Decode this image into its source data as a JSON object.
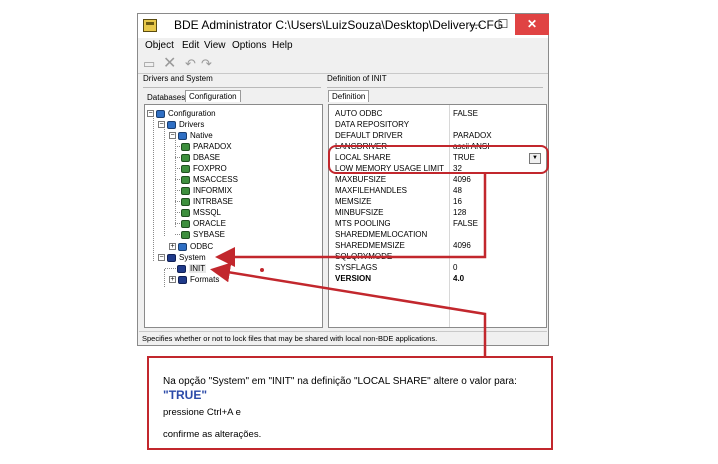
{
  "window": {
    "title": "BDE Administrator  C:\\Users\\LuizSouza\\Desktop\\Delivery.CFG",
    "minimize": "—",
    "maximize": "☐",
    "close": "✕"
  },
  "menu": [
    "Object",
    "Edit",
    "View",
    "Options",
    "Help"
  ],
  "left_panel": {
    "header": "Drivers and System",
    "tabs": [
      "Databases",
      "Configuration"
    ],
    "active_tab": "Configuration",
    "tree": {
      "configuration": "Configuration",
      "drivers": "Drivers",
      "native": "Native",
      "native_drivers": [
        "PARADOX",
        "DBASE",
        "FOXPRO",
        "MSACCESS",
        "INFORMIX",
        "INTRBASE",
        "MSSQL",
        "ORACLE",
        "SYBASE"
      ],
      "odbc": "ODBC",
      "system": "System",
      "init": "INIT",
      "formats": "Formats"
    }
  },
  "right_panel": {
    "header": "Definition of INIT",
    "tab": "Definition",
    "rows": [
      {
        "key": "AUTO ODBC",
        "value": "FALSE"
      },
      {
        "key": "DATA REPOSITORY",
        "value": ""
      },
      {
        "key": "DEFAULT DRIVER",
        "value": "PARADOX"
      },
      {
        "key": "LANGDRIVER",
        "value": "ascii ANSI"
      },
      {
        "key": "LOCAL SHARE",
        "value": "TRUE"
      },
      {
        "key": "LOW MEMORY USAGE LIMIT",
        "value": "32"
      },
      {
        "key": "MAXBUFSIZE",
        "value": "4096"
      },
      {
        "key": "MAXFILEHANDLES",
        "value": "48"
      },
      {
        "key": "MEMSIZE",
        "value": "16"
      },
      {
        "key": "MINBUFSIZE",
        "value": "128"
      },
      {
        "key": "MTS POOLING",
        "value": "FALSE"
      },
      {
        "key": "SHAREDMEMLOCATION",
        "value": ""
      },
      {
        "key": "SHAREDMEMSIZE",
        "value": "4096"
      },
      {
        "key": "SQLQRYMODE",
        "value": ""
      },
      {
        "key": "SYSFLAGS",
        "value": "0"
      },
      {
        "key": "VERSION",
        "value": "4.0"
      }
    ],
    "dropdown_arrow": "▼"
  },
  "status_bar": "Specifies whether or not to lock files that may be shared with local non-BDE applications.",
  "callout": {
    "line1": "Na opção \"System\" em \"INIT\" na definição \"LOCAL SHARE\" altere o valor para:",
    "line2": "\"TRUE\"",
    "line3": "pressione Ctrl+A e",
    "line4": "confirme as alterações."
  },
  "colors": {
    "annotation_red": "#c2272d",
    "highlight_blue": "#2b4aa8"
  }
}
